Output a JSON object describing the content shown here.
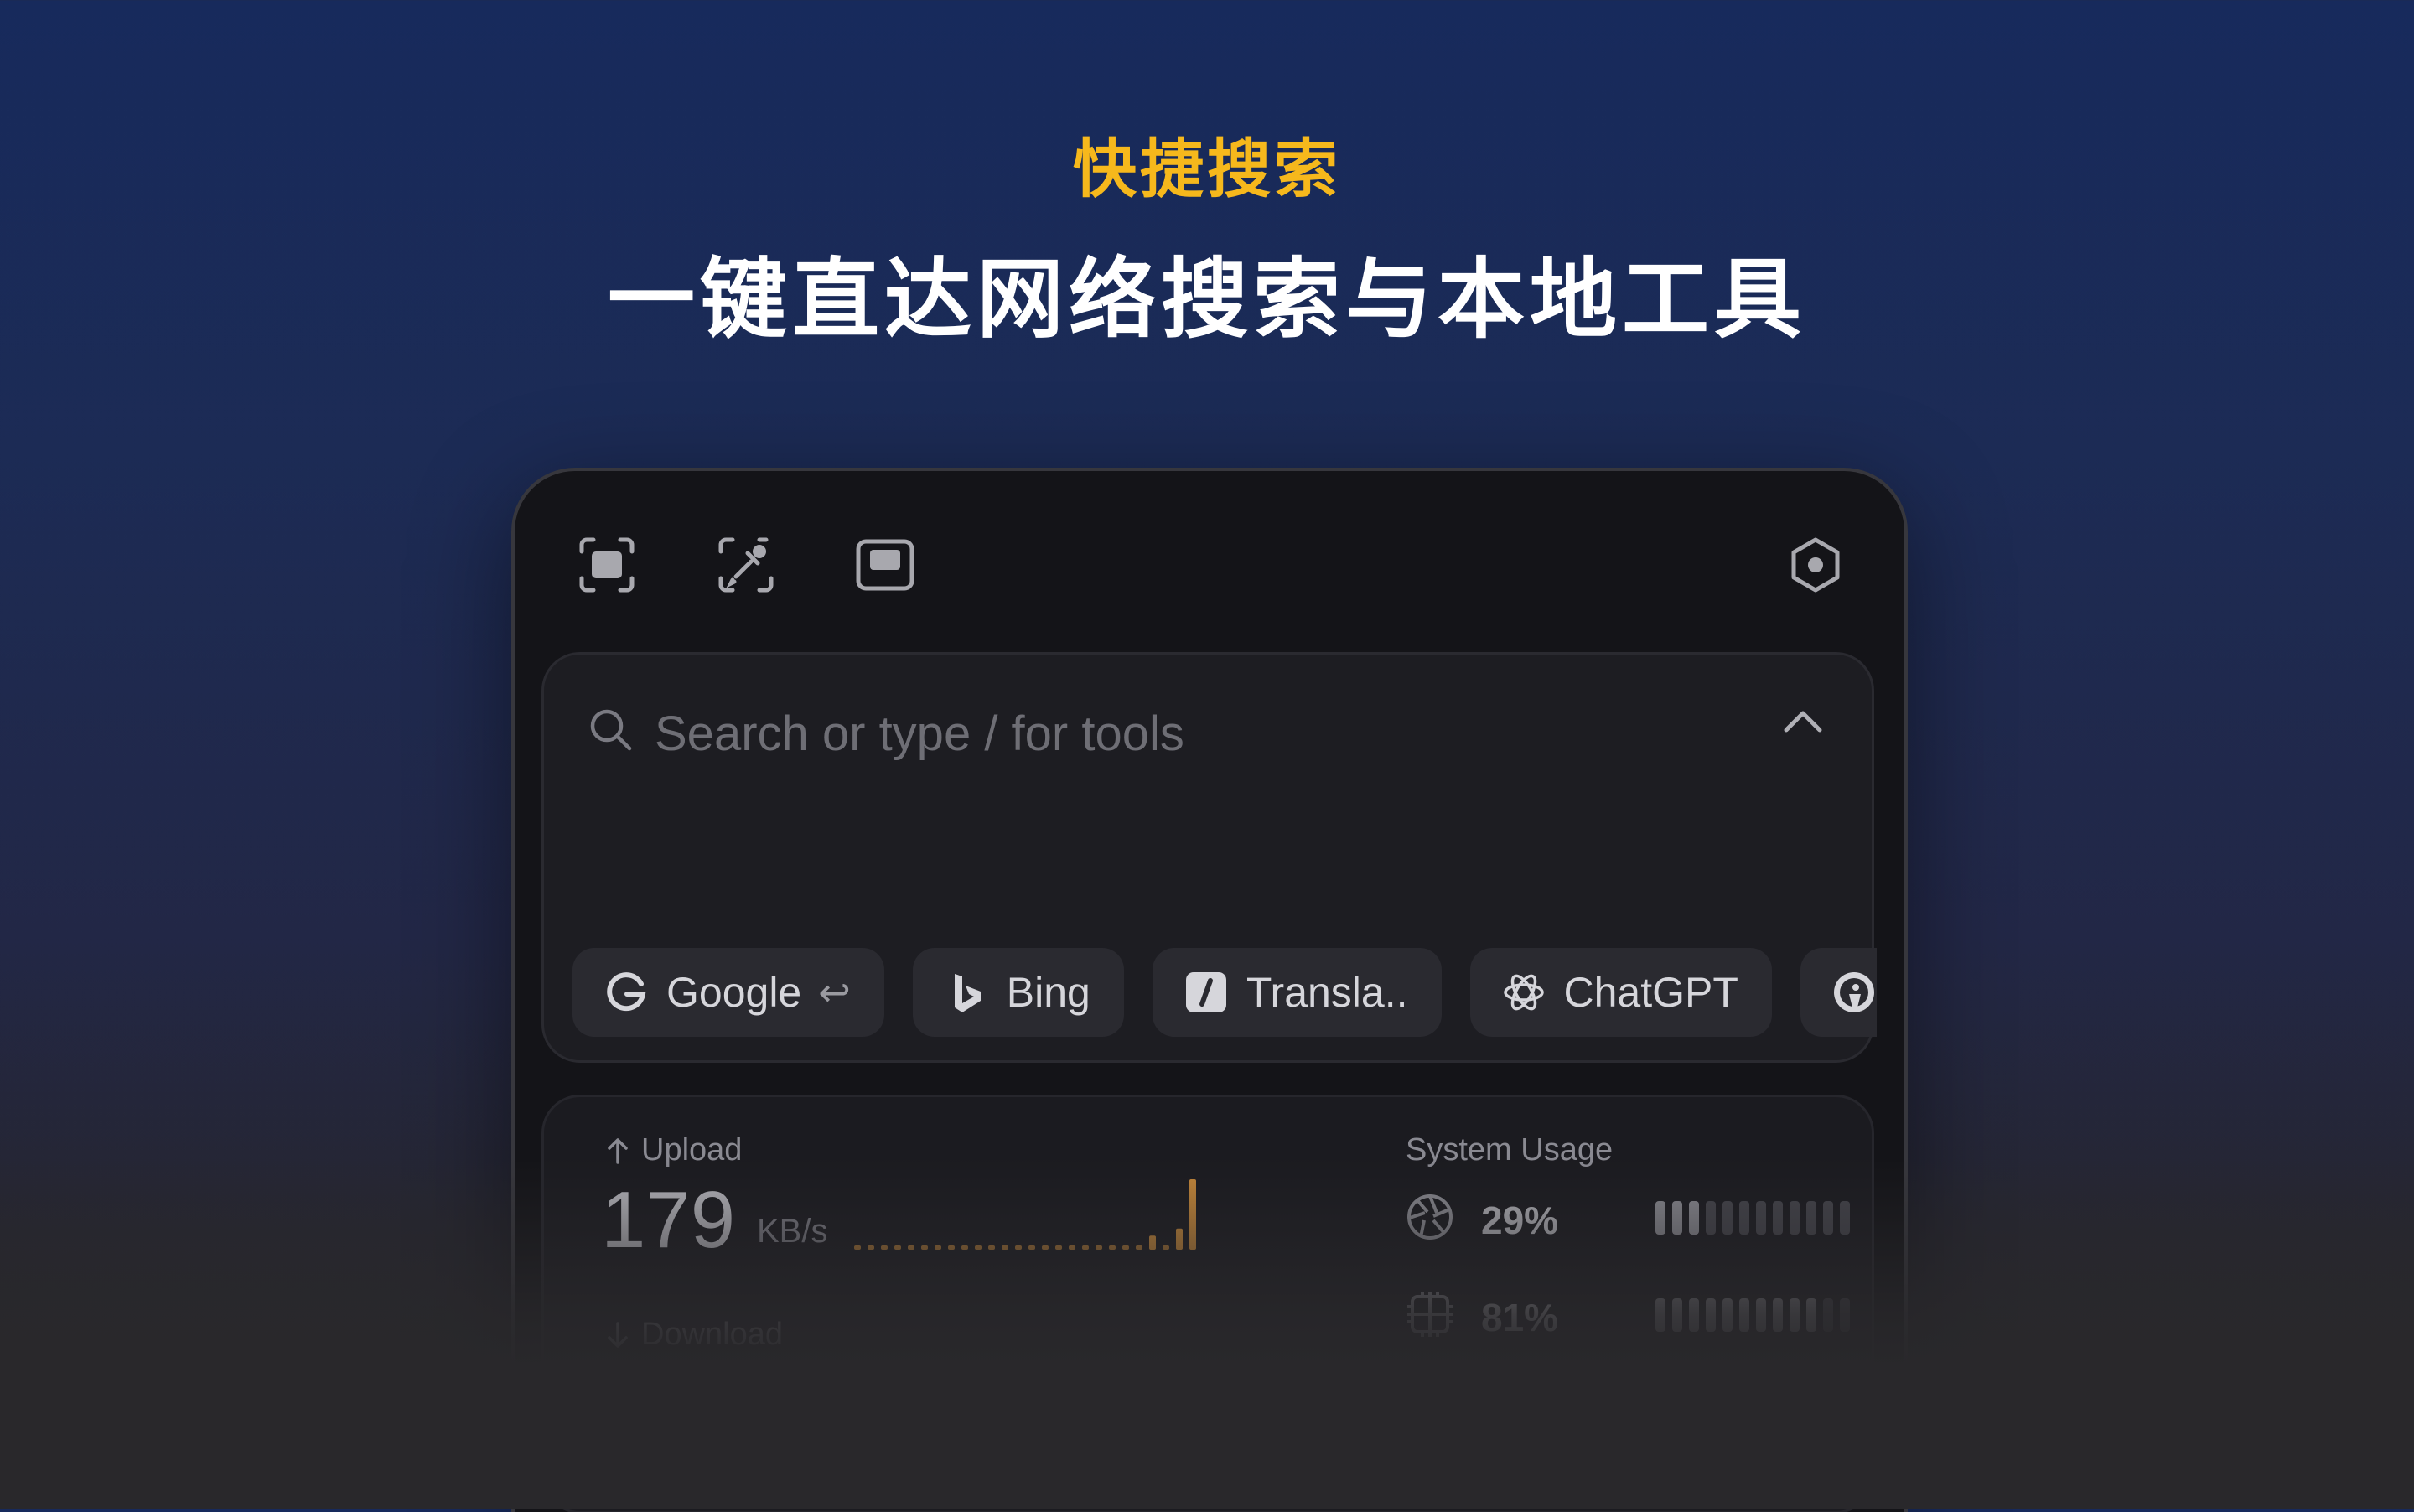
{
  "hero": {
    "tag": "快捷搜索",
    "title": "一键直达网络搜索与本地工具"
  },
  "colors": {
    "accent_yellow": "#f6b81c",
    "panel_bg": "#141418",
    "upload_bar": "#c98a3a"
  },
  "toolbar": {
    "icons": [
      "screenshot-icon",
      "color-picker-icon",
      "window-icon"
    ],
    "settings_icon": "settings-hexagon-icon"
  },
  "search": {
    "placeholder": "Search or type / for tools",
    "value": ""
  },
  "engines": [
    {
      "label": "Google",
      "icon": "google-icon",
      "shortcut": "↩"
    },
    {
      "label": "Bing",
      "icon": "bing-icon"
    },
    {
      "label": "Transla..",
      "icon": "translate-icon"
    },
    {
      "label": "ChatGPT",
      "icon": "chatgpt-icon"
    },
    {
      "label": "",
      "icon": "duckduckgo-icon"
    }
  ],
  "stats": {
    "upload": {
      "label": "Upload",
      "value": "179",
      "unit": "KB/s"
    },
    "download": {
      "label": "Download"
    },
    "system": {
      "label": "System Usage",
      "cpu": {
        "percent": "29%",
        "level": 0.29
      },
      "memory": {
        "percent": "81%",
        "level": 0.81
      }
    },
    "upload_history": [
      0.05,
      0.05,
      0.05,
      0.05,
      0.05,
      0.05,
      0.05,
      0.05,
      0.05,
      0.05,
      0.05,
      0.05,
      0.05,
      0.05,
      0.05,
      0.05,
      0.05,
      0.05,
      0.05,
      0.05,
      0.05,
      0.05,
      0.2,
      0.05,
      0.3,
      1.0
    ]
  }
}
